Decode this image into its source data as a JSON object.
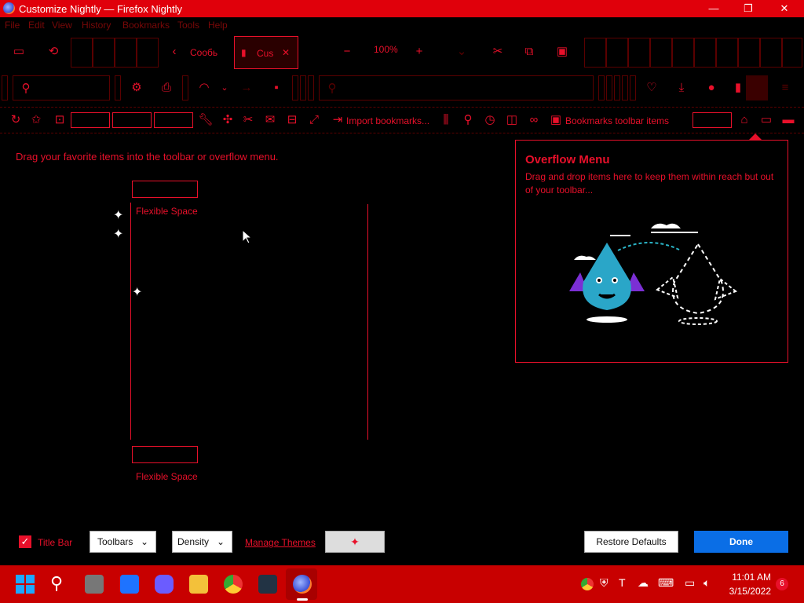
{
  "window": {
    "title": "Customize Nightly — Firefox Nightly",
    "min": "—",
    "max": "❐",
    "close": "✕"
  },
  "menubar": [
    "File",
    "Edit",
    "View",
    "History",
    "Bookmarks",
    "Tools",
    "Help"
  ],
  "tabs": {
    "back_label": "Сообь",
    "active_label": "Cus",
    "zoom": "100%"
  },
  "bookmarks_bar": {
    "import": "Import bookmarks...",
    "bookmarks_items": "Bookmarks toolbar items"
  },
  "content": {
    "instruction": "Drag your favorite items into the toolbar or overflow menu.",
    "flex_space_1": "Flexible Space",
    "flex_space_2": "Flexible Space"
  },
  "overflow": {
    "title": "Overflow Menu",
    "desc": "Drag and drop items here to keep them within reach but out of your toolbar..."
  },
  "footer": {
    "titlebar_label": "Title Bar",
    "toolbars": "Toolbars",
    "density": "Density",
    "manage_themes": "Manage Themes",
    "restore": "Restore Defaults",
    "done": "Done"
  },
  "tray": {
    "time": "11:01 AM",
    "date": "3/15/2022",
    "notif": "6"
  },
  "colors": {
    "accent": "#e8102a",
    "titlebar": "#e0000b",
    "taskbar": "#c80000",
    "done_blue": "#0a6ee6"
  }
}
